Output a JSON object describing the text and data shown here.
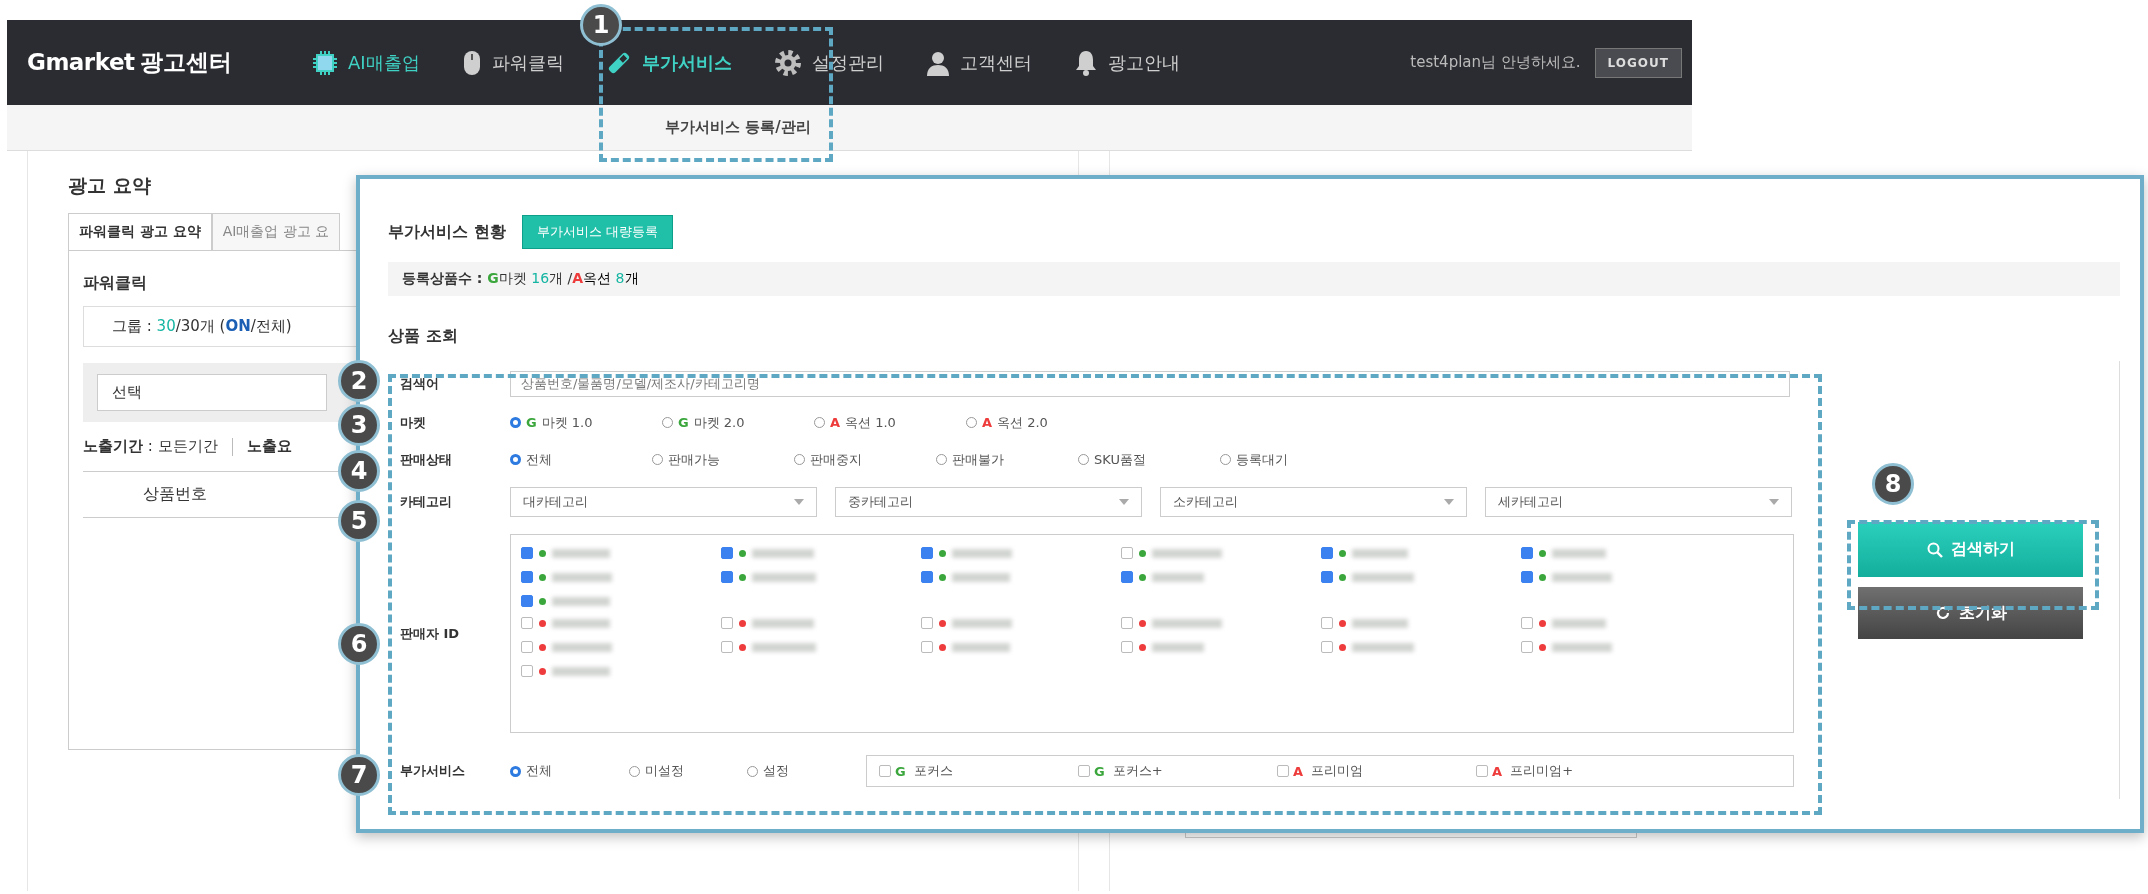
{
  "header": {
    "logo_brand": "Gmarket",
    "logo_text": "광고센터",
    "nav": [
      {
        "kind": "chip",
        "label": "AI매출업",
        "highlighted": true,
        "selected": false
      },
      {
        "kind": "mouse",
        "label": "파워클릭",
        "highlighted": false,
        "selected": false
      },
      {
        "kind": "pen",
        "label": "부가서비스",
        "highlighted": false,
        "selected": true
      },
      {
        "kind": "gear",
        "label": "설정관리",
        "highlighted": false,
        "selected": false
      },
      {
        "kind": "person",
        "label": "고객센터",
        "highlighted": false,
        "selected": false
      },
      {
        "kind": "bell",
        "label": "광고안내",
        "highlighted": false,
        "selected": false
      }
    ],
    "greeting": "test4plan님 안녕하세요.",
    "logout": "LOGOUT",
    "submenu": "부가서비스 등록/관리"
  },
  "summary": {
    "title": "광고 요약",
    "tabs": [
      {
        "label": "파워클릭 광고 요약",
        "selected": true
      },
      {
        "label": "AI매출업 광고 요",
        "selected": false
      }
    ],
    "section": "파워클릭",
    "group": [
      {
        "text": "그룹 : ",
        "color": "#333333",
        "bold": false
      },
      {
        "text": "30",
        "color": "#14b5a2",
        "bold": false
      },
      {
        "text": "/30개 (",
        "color": "#333333",
        "bold": false
      },
      {
        "text": "ON",
        "color": "#1a5fb4",
        "bold": true
      },
      {
        "text": "/전체)",
        "color": "#333333",
        "bold": false
      }
    ],
    "select": "선택",
    "period": "**노출기간** : 모든기간",
    "period_cut": "노출요",
    "columns": [
      "상품번호"
    ]
  },
  "panel": {
    "status_title": "부가서비스 현황",
    "bulk_button": "부가서비스 대량등록",
    "counts": [
      {
        "text": "등록상품수 : ",
        "color": "#333333",
        "bold": true
      },
      {
        "text": "G",
        "color": "#3aa63c",
        "bold": true
      },
      {
        "text": "마켓 ",
        "color": "#333333",
        "bold": false
      },
      {
        "text": "16",
        "color": "#14b5a2",
        "bold": false
      },
      {
        "text": "개 /",
        "color": "#333333",
        "bold": false
      },
      {
        "text": "A",
        "color": "#ee3b3b",
        "bold": true
      },
      {
        "text": "옥션 ",
        "color": "#000000",
        "bold": false
      },
      {
        "text": "8",
        "color": "#14b5a2",
        "bold": false
      },
      {
        "text": "개",
        "color": "#000000",
        "bold": false
      }
    ],
    "search_title": "상품 조회",
    "rows": [
      {
        "kind": "text",
        "label": "검색어",
        "placeholder": "상품번호/물품명/모델/제조사/카테고리명"
      },
      {
        "kind": "radio",
        "label": "마켓",
        "options": [
          {
            "mark": "G",
            "color": "#3aa63c",
            "text": "마켓 1.0",
            "selected": true
          },
          {
            "mark": "G",
            "color": "#3aa63c",
            "text": "마켓 2.0",
            "selected": false
          },
          {
            "mark": "A",
            "color": "#ee3b3b",
            "text": "옥션 1.0",
            "selected": false
          },
          {
            "mark": "A",
            "color": "#ee3b3b",
            "text": "옥션 2.0",
            "selected": false
          }
        ]
      },
      {
        "kind": "radio",
        "label": "판매상태",
        "options": [
          {
            "text": "전체",
            "selected": true
          },
          {
            "text": "판매가능",
            "selected": false
          },
          {
            "text": "판매중지",
            "selected": false
          },
          {
            "text": "판매불가",
            "selected": false
          },
          {
            "text": "SKU품절",
            "selected": false
          },
          {
            "text": "등록대기",
            "selected": false
          }
        ]
      },
      {
        "kind": "select",
        "label": "카테고리",
        "selects": [
          "대카테고리",
          "중카테고리",
          "소카테고리",
          "세카테고리"
        ]
      },
      {
        "kind": "sellers",
        "label": "판매자 ID",
        "groups": [
          {
            "color": "#3aa63c",
            "items": [
              {
                "checked": true
              },
              {
                "checked": true
              },
              {
                "checked": true
              },
              {
                "checked": false
              },
              {
                "checked": true
              },
              {
                "checked": true
              },
              {
                "checked": true
              },
              {
                "checked": true
              },
              {
                "checked": true
              },
              {
                "checked": true
              },
              {
                "checked": true
              },
              {
                "checked": true
              },
              {
                "checked": true
              }
            ]
          },
          {
            "color": "#ee3b3b",
            "items": [
              {
                "checked": false
              },
              {
                "checked": false
              },
              {
                "checked": false
              },
              {
                "checked": false
              },
              {
                "checked": false
              },
              {
                "checked": false
              },
              {
                "checked": false
              },
              {
                "checked": false
              },
              {
                "checked": false
              },
              {
                "checked": false
              },
              {
                "checked": false
              },
              {
                "checked": false
              },
              {
                "checked": false
              }
            ]
          }
        ]
      },
      {
        "kind": "addons",
        "label": "부가서비스",
        "options": [
          {
            "text": "전체",
            "selected": true
          },
          {
            "text": "미설정",
            "selected": false
          },
          {
            "text": "설정",
            "selected": false
          }
        ],
        "checks": [
          {
            "mark": "G",
            "color": "#3aa63c",
            "text": "포커스",
            "checked": false
          },
          {
            "mark": "G",
            "color": "#3aa63c",
            "text": "포커스+",
            "checked": false
          },
          {
            "mark": "A",
            "color": "#ee3b3b",
            "text": "프리미엄",
            "checked": false
          },
          {
            "mark": "A",
            "color": "#ee3b3b",
            "text": "프리미엄+",
            "checked": false
          }
        ]
      }
    ],
    "search_button": "검색하기",
    "reset_button": "초기화"
  },
  "callouts": [
    "1",
    "2",
    "3",
    "4",
    "5",
    "6",
    "7",
    "8"
  ]
}
